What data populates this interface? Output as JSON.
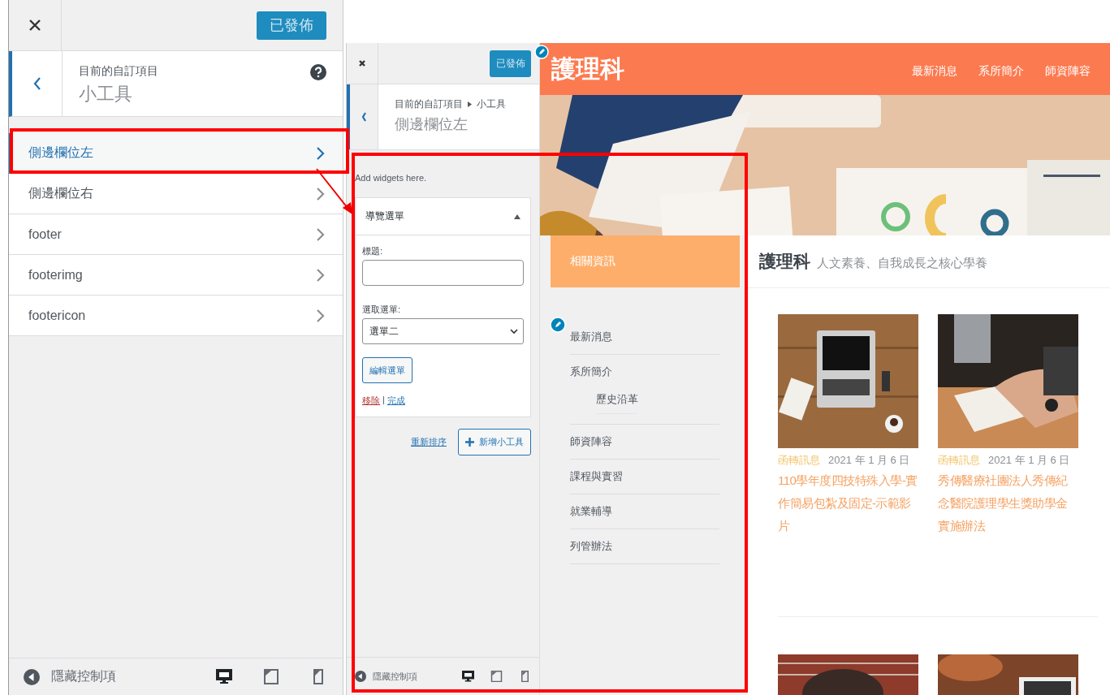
{
  "left_panel": {
    "publish_button": "已發佈",
    "breadcrumb": "目前的自訂項目",
    "section_title": "小工具",
    "items": [
      {
        "label": "側邊欄位左",
        "selected": true
      },
      {
        "label": "側邊欄位右",
        "selected": false
      },
      {
        "label": "footer",
        "selected": false
      },
      {
        "label": "footerimg",
        "selected": false
      },
      {
        "label": "footericon",
        "selected": false
      }
    ],
    "footer": {
      "hide_controls": "隱藏控制項",
      "devices": [
        {
          "kind": "desktop",
          "selected": true
        },
        {
          "kind": "tablet",
          "selected": false
        },
        {
          "kind": "mobile",
          "selected": false
        }
      ]
    }
  },
  "inner_panel": {
    "publish_button": "已發佈",
    "breadcrumb": [
      "目前的自訂項目",
      "小工具"
    ],
    "section_title": "側邊欄位左",
    "hint": "Add widgets here.",
    "widget": {
      "title": "導覽選單",
      "expanded": true,
      "fields": [
        {
          "kind": "text",
          "label": "標題:"
        },
        {
          "kind": "select",
          "label": "選取選單:",
          "value": "選單二"
        }
      ],
      "edit_button": "編輯選單",
      "remove_link": "移除",
      "link_separator": "|",
      "done_link": "完成"
    },
    "reorder_link": "重新排序",
    "add_widget_button": "新增小工具",
    "footer": {
      "hide_controls": "隱藏控制項",
      "devices": [
        {
          "kind": "desktop",
          "selected": true
        },
        {
          "kind": "tablet",
          "selected": false
        },
        {
          "kind": "mobile",
          "selected": false
        }
      ]
    }
  },
  "site": {
    "site_title": "護理科",
    "nav": [
      "最新消息",
      "系所簡介",
      "師資陣容"
    ],
    "sidebar": {
      "title": "相關資訊",
      "menu": [
        {
          "label": "最新消息"
        },
        {
          "label": "系所簡介",
          "children": [
            {
              "label": "歷史沿革"
            }
          ]
        },
        {
          "label": "師資陣容"
        },
        {
          "label": "課程與實習"
        },
        {
          "label": "就業輔導"
        },
        {
          "label": "列管辦法"
        }
      ]
    },
    "heading": "護理科",
    "tagline": "人文素養、自我成長之核心學養",
    "posts": [
      {
        "kind": "laptop",
        "category": "函轉訊息",
        "date": "2021 年 1 月 6 日",
        "title": "110學年度四技特殊入學-實作簡易包紮及固定-示範影片"
      },
      {
        "kind": "writing",
        "category": "函轉訊息",
        "date": "2021 年 1 月 6 日",
        "title": "秀傳醫療社團法人秀傳紀念醫院護理學生獎助學金實施辦法"
      },
      {
        "kind": "brick"
      },
      {
        "kind": "desk"
      }
    ]
  }
}
